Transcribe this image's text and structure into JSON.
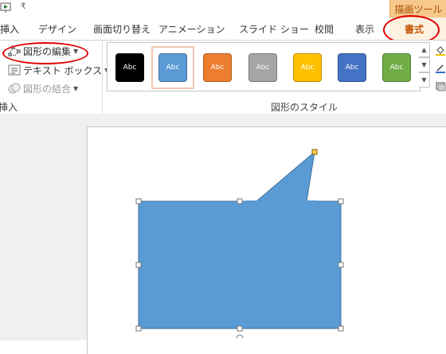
{
  "quick_access": {
    "more_glyph": "₹"
  },
  "context_header": "描画ツール",
  "tabs": [
    {
      "label": "挿入"
    },
    {
      "label": "デザイン"
    },
    {
      "label": "画面切り替え"
    },
    {
      "label": "アニメーション"
    },
    {
      "label": "スライド ショー"
    },
    {
      "label": "校閲"
    },
    {
      "label": "表示"
    },
    {
      "label": "書式",
      "active": true
    }
  ],
  "insert_group": {
    "edit_shape": "図形の編集",
    "text_box": "テキスト ボックス",
    "merge_shapes": "図形の結合",
    "label": "挿入"
  },
  "shape_styles": {
    "label": "図形のスタイル",
    "swatches": [
      {
        "text": "Abc",
        "fill": "#000000",
        "border": "#000000"
      },
      {
        "text": "Abc",
        "fill": "#5b9bd5",
        "border": "#41719c",
        "selected": true
      },
      {
        "text": "Abc",
        "fill": "#ed7d31",
        "border": "#ae5a21"
      },
      {
        "text": "Abc",
        "fill": "#a5a5a5",
        "border": "#787878"
      },
      {
        "text": "Abc",
        "fill": "#ffc000",
        "border": "#bc8c00"
      },
      {
        "text": "Abc",
        "fill": "#4472c4",
        "border": "#2f528f"
      },
      {
        "text": "Abc",
        "fill": "#70ad47",
        "border": "#507e32"
      }
    ]
  },
  "shape": {
    "type": "speech-callout",
    "fill": "#5b9bd5",
    "stroke": "#41719c"
  },
  "colors": {
    "accent": "#c5570b",
    "highlight": "#e00000",
    "context_header_bg": "#f6c88a"
  }
}
